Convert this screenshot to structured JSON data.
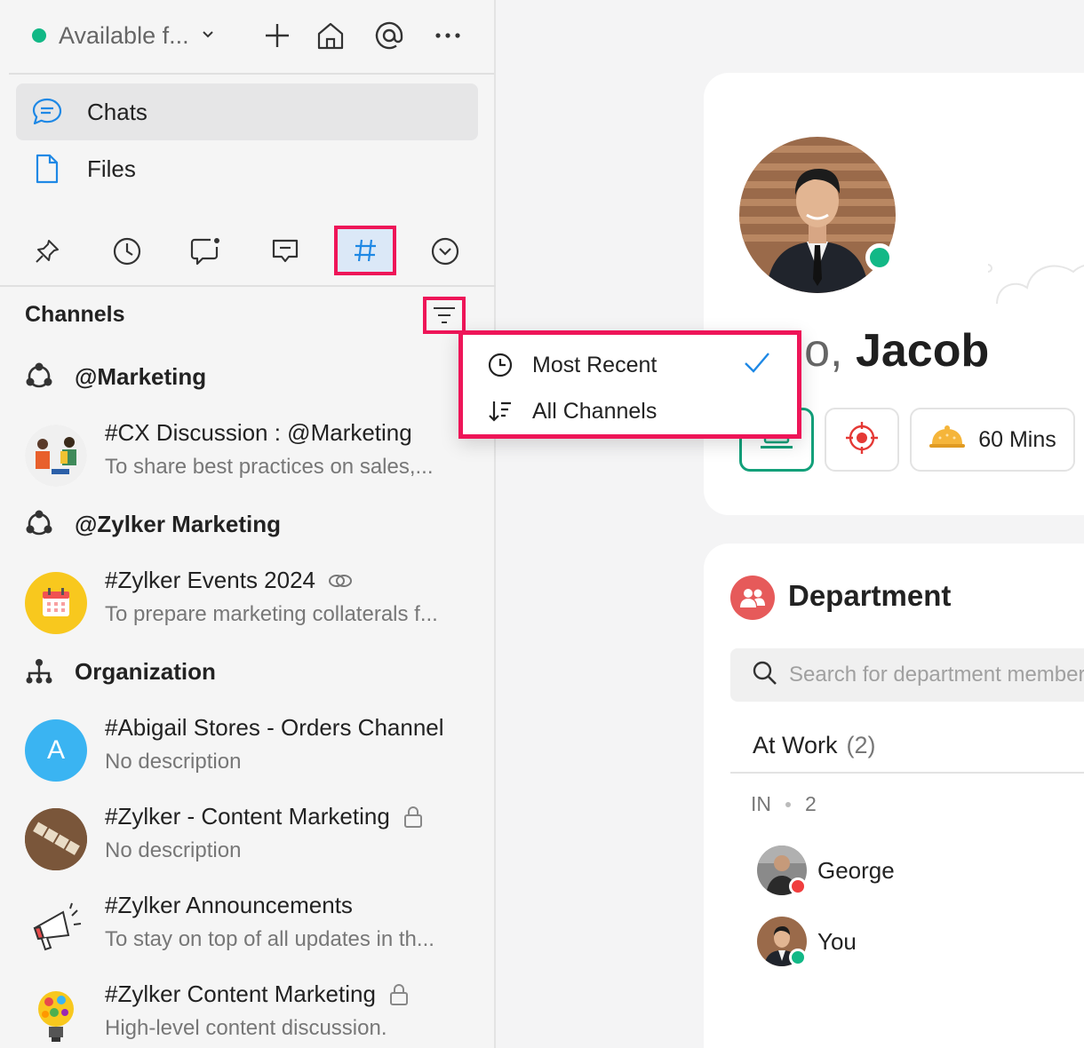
{
  "topbar": {
    "status_label": "Available f...",
    "status_color": "#12b886",
    "icons": [
      "add-icon",
      "home-icon",
      "mention-icon",
      "more-icon"
    ]
  },
  "nav": {
    "chats": "Chats",
    "files": "Files"
  },
  "tabs": [
    "pin-icon",
    "clock-icon",
    "chat-bubble-icon",
    "comment-icon",
    "hash-icon",
    "chevron-circle-icon"
  ],
  "channels": {
    "header": "Channels",
    "groups": [
      {
        "label": "@Marketing",
        "items": [
          {
            "title": "#CX Discussion : @Marketing",
            "desc": "To share best practices on sales,..."
          }
        ]
      },
      {
        "label": "@Zylker Marketing",
        "items": [
          {
            "title": "#Zylker Events 2024",
            "desc": "To prepare marketing collaterals f..."
          }
        ]
      },
      {
        "label": "Organization",
        "items": [
          {
            "title": "#Abigail Stores - Orders Channel",
            "desc": "No description",
            "avatar_letter": "A"
          },
          {
            "title": "#Zylker - Content Marketing",
            "desc": "No description"
          },
          {
            "title": "#Zylker Announcements",
            "desc": "To stay on top of all updates in th..."
          },
          {
            "title": "#Zylker Content Marketing",
            "desc": "High-level content discussion."
          }
        ]
      }
    ]
  },
  "dropdown": {
    "items": [
      "Most Recent",
      "All Channels"
    ],
    "selected": "Most Recent"
  },
  "profile": {
    "greeting_partial": "llo,",
    "name": "Jacob",
    "chip_time": "60 Mins"
  },
  "department": {
    "title": "Department",
    "search_placeholder": "Search for department members",
    "at_work_label": "At Work",
    "at_work_count": "(2)",
    "in_label": "IN",
    "in_count": "2",
    "members": [
      {
        "name": "George",
        "status_color": "#f03e3e"
      },
      {
        "name": "You",
        "status_color": "#12b886"
      }
    ]
  }
}
